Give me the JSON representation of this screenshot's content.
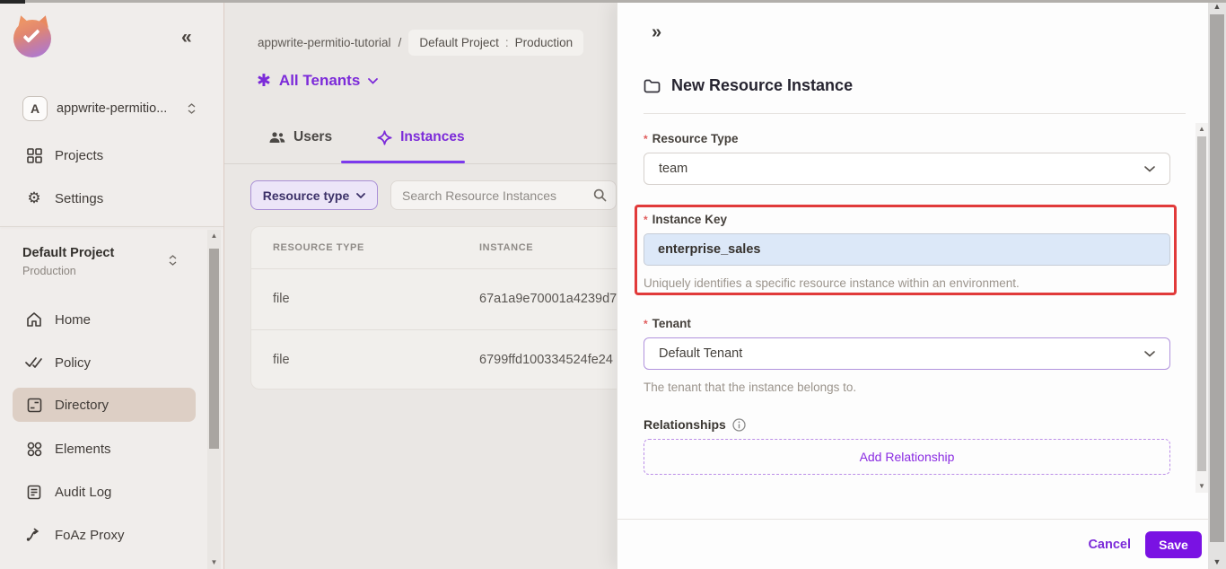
{
  "colors": {
    "accent": "#7C2BD9",
    "save": "#7A12E3",
    "red": "#E13A3A",
    "sidebar_active": "#DDCFC5",
    "key_input_bg": "#DCE8F8"
  },
  "icons": {
    "collapse": "«",
    "expand": "»",
    "tenant_asterisk": "✱",
    "gear": "⚙",
    "scroll_up": "▲",
    "scroll_down": "▼"
  },
  "sidebar": {
    "org": {
      "initial": "A",
      "name": "appwrite-permitio..."
    },
    "top_items": [
      {
        "label": "Projects"
      },
      {
        "label": "Settings"
      }
    ],
    "project": {
      "name": "Default Project",
      "env": "Production"
    },
    "nav_items": [
      {
        "label": "Home"
      },
      {
        "label": "Policy"
      },
      {
        "label": "Directory",
        "active": true
      },
      {
        "label": "Elements"
      },
      {
        "label": "Audit Log"
      },
      {
        "label": "FoAz Proxy"
      }
    ]
  },
  "main": {
    "breadcrumb": {
      "org": "appwrite-permitio-tutorial",
      "separator": "/",
      "project": "Default Project",
      "colon": ":",
      "env": "Production"
    },
    "tenant_selector": {
      "label": "All Tenants"
    },
    "tabs": [
      {
        "label": "Users"
      },
      {
        "label": "Instances",
        "active": true
      }
    ],
    "filters": {
      "resource_type_label": "Resource type",
      "search_placeholder": "Search Resource Instances"
    },
    "table": {
      "columns": [
        "RESOURCE TYPE",
        "INSTANCE"
      ],
      "rows": [
        [
          "file",
          "67a1a9e70001a4239d7"
        ],
        [
          "file",
          "6799ffd100334524fe24"
        ]
      ]
    }
  },
  "panel": {
    "title": "New Resource Instance",
    "required_marker": "*",
    "fields": {
      "resource_type": {
        "label": "Resource Type",
        "value": "team"
      },
      "instance_key": {
        "label": "Instance Key",
        "value": "enterprise_sales",
        "help": "Uniquely identifies a specific resource instance within an environment."
      },
      "tenant": {
        "label": "Tenant",
        "value": "Default Tenant",
        "help": "The tenant that the instance belongs to."
      }
    },
    "relationships": {
      "label": "Relationships",
      "add_button": "Add Relationship"
    },
    "footer": {
      "cancel": "Cancel",
      "save": "Save"
    }
  }
}
